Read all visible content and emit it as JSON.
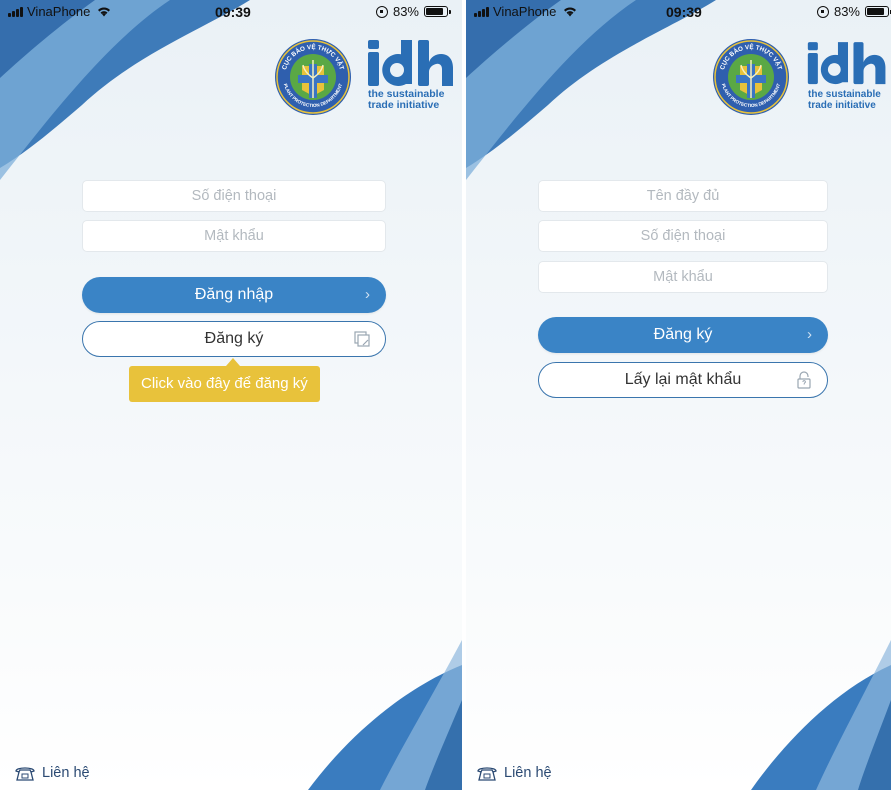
{
  "colors": {
    "primary_blue": "#3a84c6",
    "outline_blue": "#3a75ad",
    "tooltip_yellow": "#e8c23b",
    "wave_dark": "#3574b5",
    "wave_light": "#8fb8dd"
  },
  "logos": {
    "ppd_seal_top": "CỤC BẢO VỆ THỰC VẬT",
    "ppd_seal_bottom": "PLANT PROTECTION DEPARTMENT",
    "idh_text": "idh",
    "idh_tagline_1": "the sustainable",
    "idh_tagline_2": "trade initiative"
  },
  "left_screen": {
    "status_bar": {
      "carrier": "VinaPhone",
      "time": "09:39",
      "battery": "83%",
      "battery_level": 0.83
    },
    "phone_placeholder": "Số điện thoại",
    "password_placeholder": "Mật khẩu",
    "login_button": "Đăng nhập",
    "register_button": "Đăng ký",
    "tooltip": "Click vào đây để đăng ký",
    "contact_label": "Liên hệ",
    "chevron": "›"
  },
  "right_screen": {
    "status_bar": {
      "carrier": "VinaPhone",
      "time": "09:39",
      "battery": "83%",
      "battery_level": 0.83
    },
    "fullname_placeholder": "Tên đầy đủ",
    "phone_placeholder": "Số điện thoại",
    "password_placeholder": "Mật khẩu",
    "register_button": "Đăng ký",
    "recover_button": "Lấy lại mật khẩu",
    "contact_label": "Liên hệ",
    "chevron": "›"
  }
}
